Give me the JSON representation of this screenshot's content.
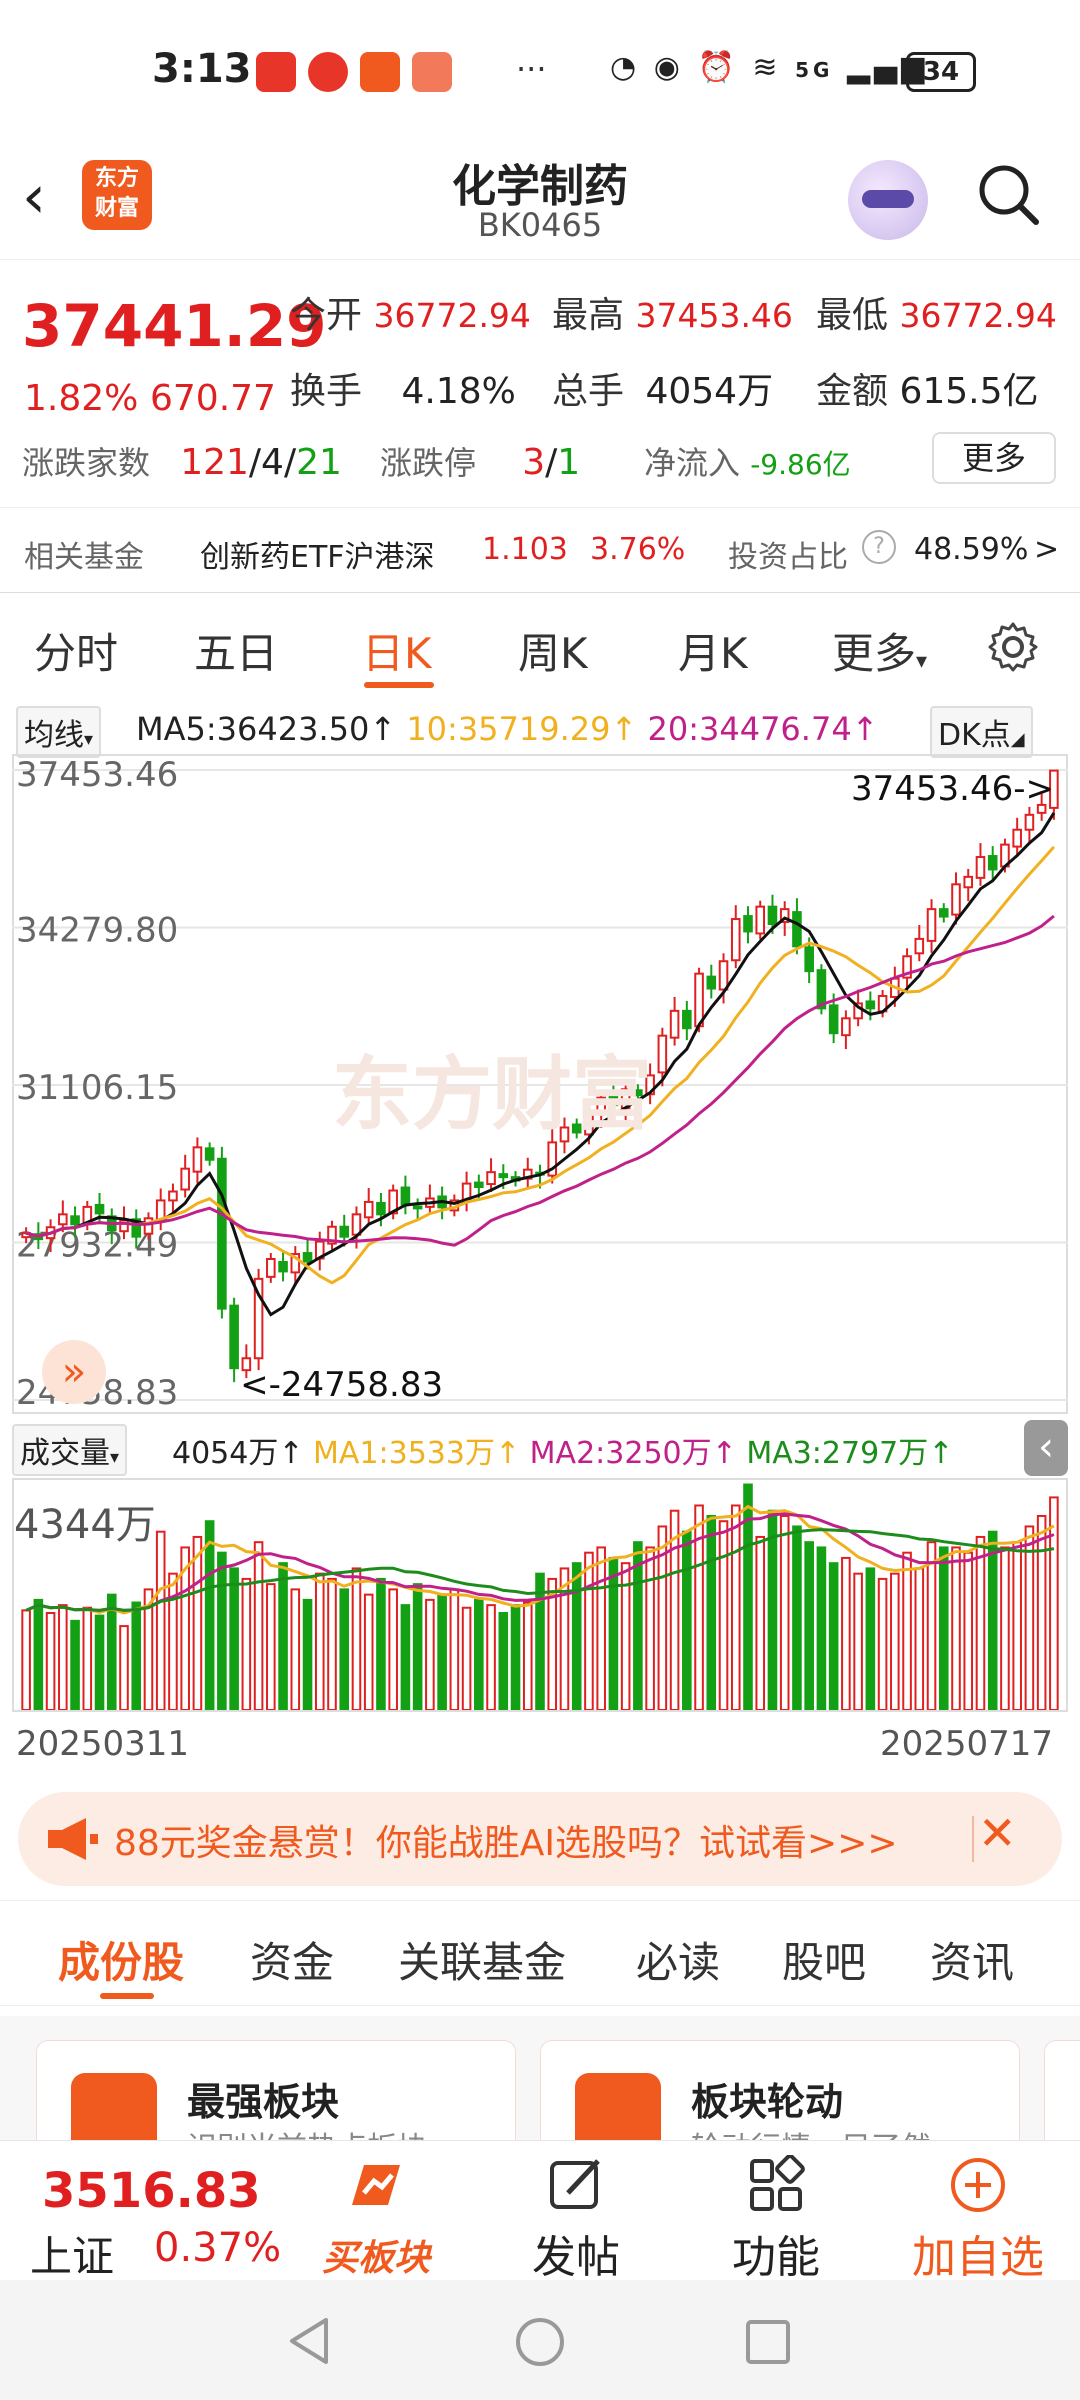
{
  "status_bar": {
    "time": "3:13",
    "dots": "···",
    "network": "5G",
    "battery": "34"
  },
  "header": {
    "logo_line1": "东方",
    "logo_line2": "财富",
    "title": "化学制药",
    "code": "BK0465"
  },
  "quote": {
    "price": "37441.29",
    "change_pct": "1.82%",
    "change": "670.77",
    "open_label": "今开",
    "open": "36772.94",
    "high_label": "最高",
    "high": "37453.46",
    "low_label": "最低",
    "low": "36772.94",
    "turnover_label": "换手",
    "turnover": "4.18%",
    "volume_label": "总手",
    "volume": "4054万",
    "amount_label": "金额",
    "amount": "615.5亿",
    "updown_label": "涨跌家数",
    "up_count": "121",
    "flat_count": "4",
    "down_count": "21",
    "slash": "/",
    "limit_label": "涨跌停",
    "limit_up": "3",
    "limit_down": "1",
    "netflow_label": "净流入",
    "netflow": "-9.86亿",
    "more_label": "更多"
  },
  "related_fund": {
    "label": "相关基金",
    "name": "创新药ETF沪港深",
    "price": "1.103",
    "pct": "3.76%",
    "ratio_label": "投资占比",
    "ratio": "48.59%",
    "arrow": ">"
  },
  "chart_tabs": [
    "分时",
    "五日",
    "日K",
    "周K",
    "月K",
    "更多"
  ],
  "ma_legend": {
    "selector": "均线",
    "ma5": "MA5:36423.50↑",
    "ma10": "10:35719.29↑",
    "ma20": "20:34476.74↑",
    "dk_label": "DK点"
  },
  "vol_legend": {
    "selector": "成交量",
    "vol": "4054万↑",
    "ma1": "MA1:3533万↑",
    "ma2": "MA2:3250万↑",
    "ma3": "MA3:2797万↑"
  },
  "chart_data": {
    "type": "candlestick",
    "y_ticks": [
      "37453.46",
      "34279.80",
      "31106.15",
      "27932.49",
      "24758.83"
    ],
    "ylim": [
      24758.83,
      37453.46
    ],
    "max_annotation": "37453.46->",
    "min_annotation": "<-24758.83",
    "x_start": "20250311",
    "x_end": "20250717",
    "volume_max_label": "4344万",
    "colors": {
      "up": "#e02020",
      "down": "#14a014",
      "ma5": "#111111",
      "ma10": "#f0b020",
      "ma20": "#c0208a",
      "vol_ma3": "#1c8c1c"
    },
    "closes": [
      28120,
      28000,
      28240,
      28500,
      28300,
      28650,
      28520,
      28180,
      28380,
      28050,
      28420,
      28780,
      28960,
      29420,
      29850,
      29600,
      26600,
      25400,
      25600,
      27200,
      27600,
      27350,
      27700,
      27550,
      27950,
      28250,
      28050,
      28500,
      28750,
      28500,
      28980,
      28700,
      28650,
      28820,
      28640,
      28780,
      29120,
      29050,
      29350,
      29250,
      29180,
      29400,
      29300,
      29950,
      30250,
      30150,
      30520,
      30850,
      30700,
      31020,
      30900,
      31300,
      32100,
      32600,
      32250,
      33350,
      33050,
      33600,
      34450,
      34200,
      34700,
      34350,
      34650,
      33900,
      33400,
      32650,
      32150,
      32450,
      32750,
      32650,
      32900,
      33250,
      33700,
      34050,
      34650,
      34500,
      35150,
      35300,
      35700,
      35450,
      35950,
      36250,
      36550,
      36750,
      37441
    ],
    "volumes": [
      1900,
      2100,
      1850,
      2000,
      1700,
      1950,
      1800,
      2200,
      1600,
      2050,
      2300,
      3400,
      2600,
      3100,
      3300,
      3600,
      3000,
      2700,
      2500,
      3200,
      2400,
      2800,
      2300,
      2100,
      2600,
      2500,
      2300,
      2700,
      2200,
      2500,
      2300,
      2000,
      2400,
      2100,
      2200,
      2300,
      1950,
      2100,
      2000,
      1850,
      2000,
      2050,
      2600,
      2500,
      2700,
      2800,
      3000,
      3100,
      2900,
      2800,
      3200,
      3100,
      3500,
      3800,
      3400,
      3900,
      3700,
      3600,
      3900,
      4300,
      3300,
      3800,
      3700,
      3500,
      3200,
      3100,
      2800,
      2900,
      2600,
      2700,
      2500,
      2600,
      3000,
      2700,
      3200,
      3100,
      3100,
      3000,
      3300,
      3400,
      3100,
      3200,
      3500,
      3700,
      4054
    ]
  },
  "banner": {
    "text": "88元奖金悬赏！你能战胜AI选股吗？试试看>>>",
    "close": "✕"
  },
  "sub_tabs": [
    "成份股",
    "资金",
    "关联基金",
    "必读",
    "股吧",
    "资讯"
  ],
  "cards": [
    {
      "title": "最强板块",
      "subtitle": "识别当前热点板块"
    },
    {
      "title": "板块轮动",
      "subtitle": "轮动行情一目了然"
    }
  ],
  "bottom_bar": {
    "index_price": "3516.83",
    "index_name": "上证",
    "index_pct": "0.37%",
    "buy_label": "买板块",
    "post_label": "发帖",
    "func_label": "功能",
    "add_label": "加自选"
  }
}
